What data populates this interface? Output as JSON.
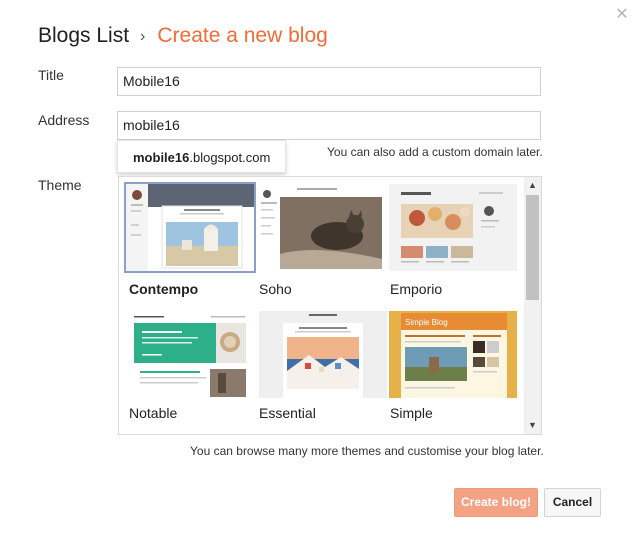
{
  "dialog": {
    "close_icon": "close-icon",
    "breadcrumb": {
      "parent": "Blogs List",
      "separator": "›",
      "current": "Create a new blog"
    },
    "title_field": {
      "label": "Title",
      "value": "Mobile16"
    },
    "address_field": {
      "label": "Address",
      "value": "mobile16",
      "suggestion_bold": "mobile16",
      "suggestion_rest": ".blogspot.com",
      "hint": "You can also add a custom domain later."
    },
    "theme_field": {
      "label": "Theme",
      "themes": [
        {
          "name": "Contempo",
          "selected": true
        },
        {
          "name": "Soho",
          "selected": false
        },
        {
          "name": "Emporio",
          "selected": false
        },
        {
          "name": "Notable",
          "selected": false
        },
        {
          "name": "Essential",
          "selected": false
        },
        {
          "name": "Simple",
          "selected": false
        }
      ],
      "hint": "You can browse many more themes and customise your blog later."
    },
    "buttons": {
      "create": "Create blog!",
      "cancel": "Cancel"
    },
    "colors": {
      "accent": "#f36c36",
      "create_button": "#f3a384",
      "selection_border": "#8aa0c8"
    }
  }
}
